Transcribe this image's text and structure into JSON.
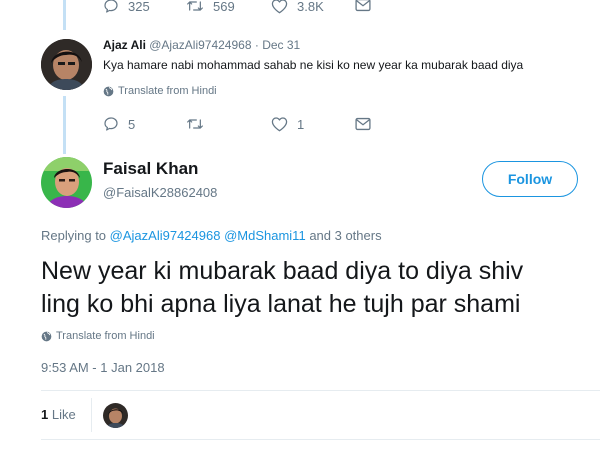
{
  "prev_tweet": {
    "replies": "325",
    "retweets": "569",
    "likes": "3.8K"
  },
  "reply_tweet": {
    "name": "Ajaz Ali",
    "handle": "@AjazAli97424968",
    "date": "Dec 31",
    "text": "Kya hamare nabi mohammad sahab ne kisi ko new year ka mubarak baad diya",
    "translate": "Translate from Hindi",
    "replies": "5",
    "retweets": "",
    "likes": "1"
  },
  "main_tweet": {
    "name": "Faisal Khan",
    "handle": "@FaisalK28862408",
    "follow_label": "Follow",
    "replying_prefix": "Replying to",
    "replying_user1": "@AjazAli97424968",
    "replying_user2": "@MdShami11",
    "replying_suffix": "and 3 others",
    "text_line1": "New year ki mubarak baad diya to diya shiv",
    "text_line2": "ling ko bhi apna liya lanat he tujh par shami",
    "translate": "Translate from Hindi",
    "timestamp": "9:53 AM - 1 Jan 2018",
    "like_count": "1",
    "like_label": "Like"
  },
  "colors": {
    "accent": "#1b95e0",
    "muted": "#657786",
    "thread_line": "#c4e0f5"
  }
}
